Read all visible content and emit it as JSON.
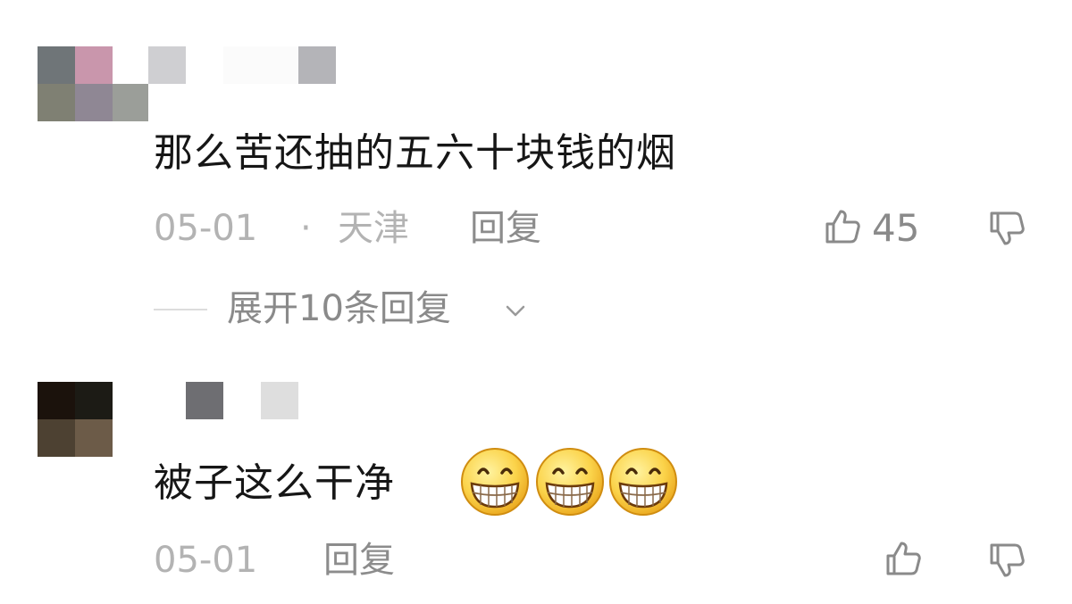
{
  "comments": [
    {
      "text": "那么苦还抽的五六十块钱的烟",
      "date": "05-01",
      "separator": "·",
      "location": "天津",
      "reply_label": "回复",
      "like_count": "45",
      "expand_replies": "展开10条回复",
      "avatar_colors": [
        "#6f7578",
        "#c996ac",
        "#7f8073",
        "#8f8794",
        "#9b9e99"
      ],
      "name_colors": [
        "#cfcfd2",
        "#ffffff",
        "#b4b4b8"
      ]
    },
    {
      "text": "被子这么干净",
      "emoji": [
        "grinning-face-emoji",
        "grinning-face-emoji",
        "grinning-face-emoji"
      ],
      "date": "05-01",
      "reply_label": "回复",
      "avatar_colors": [
        "#1b120c",
        "#1c1b15",
        "#4d4132",
        "#6c5b48"
      ],
      "name_colors": [
        "#6e6e72",
        "#dedede"
      ]
    }
  ],
  "icons": {
    "like": "thumbs-up-outline",
    "dislike": "thumbs-down-outline",
    "expand": "chevron-down"
  },
  "colors": {
    "text": "#161616",
    "meta": "#b3b3b3",
    "secondary": "#8a8a8a"
  }
}
